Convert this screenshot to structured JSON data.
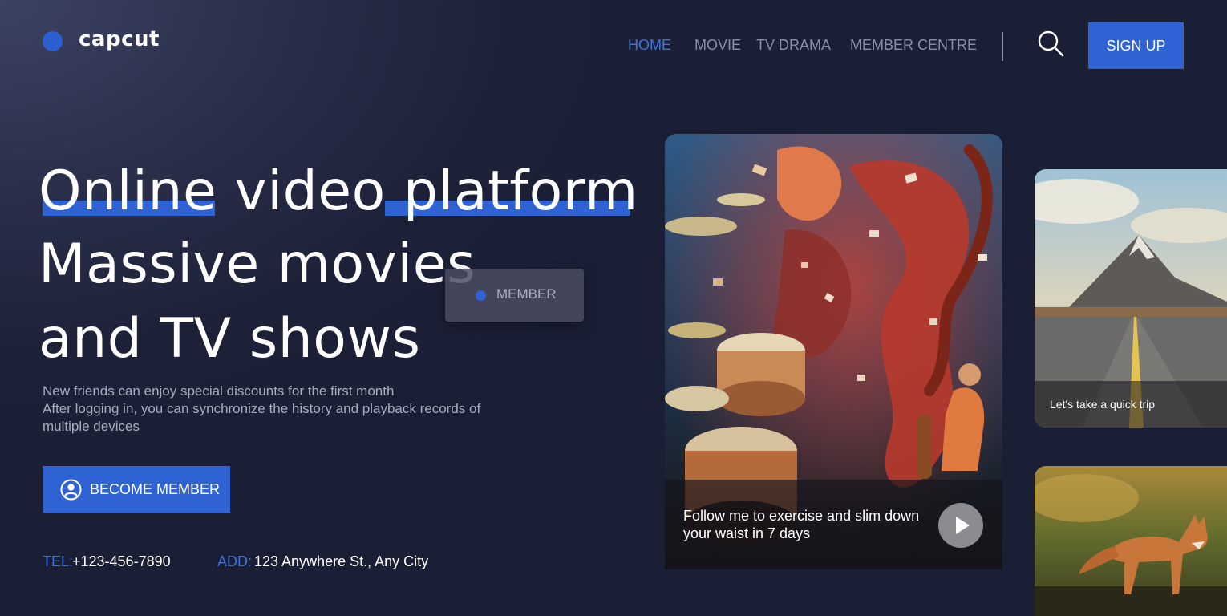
{
  "brand": {
    "name": "capcut",
    "color": "#2c5fd1"
  },
  "nav": {
    "items": [
      {
        "label": "HOME",
        "active": true
      },
      {
        "label": "MOVIE",
        "active": false
      },
      {
        "label": "TV DRAMA",
        "active": false
      },
      {
        "label": "MEMBER CENTRE",
        "active": false
      }
    ],
    "search_icon": "search-icon",
    "signup_label": "SIGN UP"
  },
  "hero": {
    "line1_word1": "Online",
    "line1_word2": "video",
    "line1_word3": "platform",
    "line2": "Massive movies",
    "line3": "and TV shows",
    "subtitle_lines": [
      "New friends can enjoy special discounts for the first month",
      "After logging in, you can synchronize the history and playback records of",
      "multiple devices"
    ],
    "member_chip_label": "MEMBER",
    "cta_label": "BECOME MEMBER",
    "cta_icon": "user-circle-icon"
  },
  "contact": {
    "tel_label": "TEL:",
    "tel_value": "+123-456-7890",
    "add_label": "ADD:",
    "add_value": "123 Anywhere St., Any City"
  },
  "cards": {
    "main": {
      "caption": "Follow me to exercise and slim down your waist in 7 days",
      "play_icon": "play-icon"
    },
    "side1": {
      "caption": "Let's take a quick trip"
    }
  },
  "colors": {
    "accent": "#2f63d3",
    "nav_active": "#3b72e0",
    "nav_inactive": "#8a8fa3",
    "background": "#1c2037"
  }
}
